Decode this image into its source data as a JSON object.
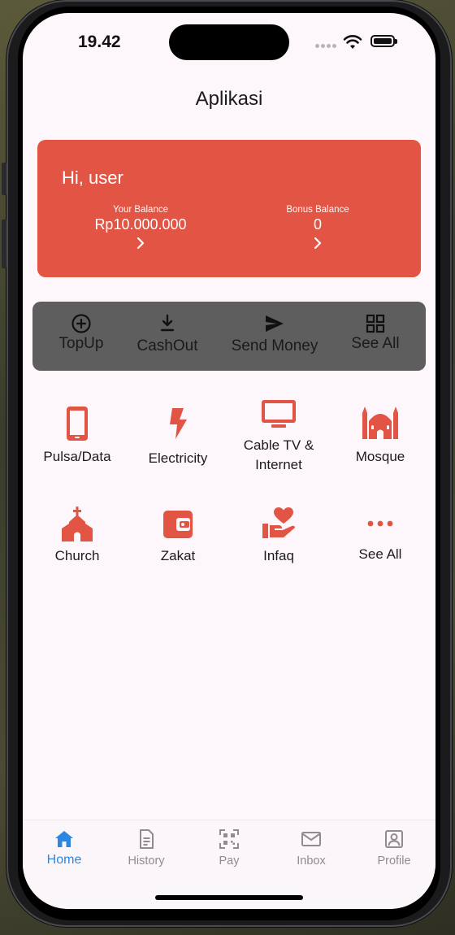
{
  "status_bar": {
    "time": "19.42"
  },
  "app": {
    "title": "Aplikasi"
  },
  "balance_card": {
    "greeting": "Hi, user",
    "your_balance_label": "Your Balance",
    "your_balance_value": "Rp10.000.000",
    "bonus_balance_label": "Bonus Balance",
    "bonus_balance_value": "0",
    "background_color": "#e25444"
  },
  "quick_actions": [
    {
      "label": "TopUp",
      "icon": "add-circle-icon"
    },
    {
      "label": "CashOut",
      "icon": "download-icon"
    },
    {
      "label": "Send Money",
      "icon": "send-icon"
    },
    {
      "label": "See All",
      "icon": "grid-icon"
    }
  ],
  "services": [
    {
      "label": "Pulsa/Data",
      "icon": "smartphone-icon"
    },
    {
      "label": "Electricity",
      "icon": "lightning-icon"
    },
    {
      "label": "Cable TV &\nInternet",
      "icon": "tv-icon"
    },
    {
      "label": "Mosque",
      "icon": "mosque-icon"
    },
    {
      "label": "Church",
      "icon": "church-icon"
    },
    {
      "label": "Zakat",
      "icon": "wallet-icon"
    },
    {
      "label": "Infaq",
      "icon": "charity-hand-heart-icon"
    },
    {
      "label": "See All",
      "icon": "more-horizontal-icon"
    }
  ],
  "bottom_nav": [
    {
      "label": "Home",
      "icon": "home-icon",
      "active": true
    },
    {
      "label": "History",
      "icon": "document-icon",
      "active": false
    },
    {
      "label": "Pay",
      "icon": "qr-code-icon",
      "active": false
    },
    {
      "label": "Inbox",
      "icon": "mail-icon",
      "active": false
    },
    {
      "label": "Profile",
      "icon": "profile-icon",
      "active": false
    }
  ],
  "colors": {
    "accent": "#e25444",
    "nav_active": "#2d87e0",
    "nav_inactive": "#8f8b90",
    "quick_bar": "#5e5e5e"
  }
}
